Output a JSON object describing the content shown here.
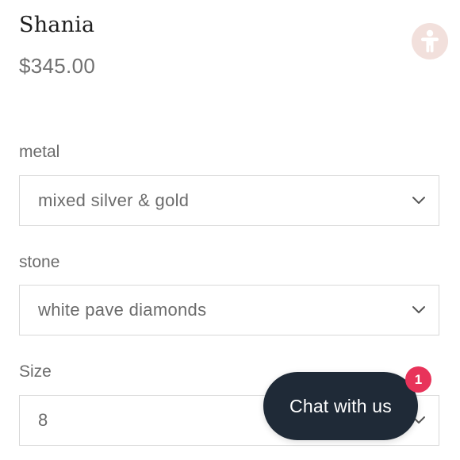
{
  "product": {
    "title": "Shania",
    "price": "$345.00"
  },
  "accessibility_button": {
    "icon": "accessibility-person-icon"
  },
  "options": [
    {
      "label": "metal",
      "selected": "mixed silver & gold"
    },
    {
      "label": "stone",
      "selected": "white pave diamonds"
    },
    {
      "label": "Size",
      "selected": "8"
    }
  ],
  "chat": {
    "label": "Chat with us",
    "badge_count": "1"
  },
  "colors": {
    "chat_background": "#1f2a37",
    "badge": "#e8335a",
    "accessibility_button_bg": "#f2e0dc",
    "border": "#d8d8d8"
  }
}
